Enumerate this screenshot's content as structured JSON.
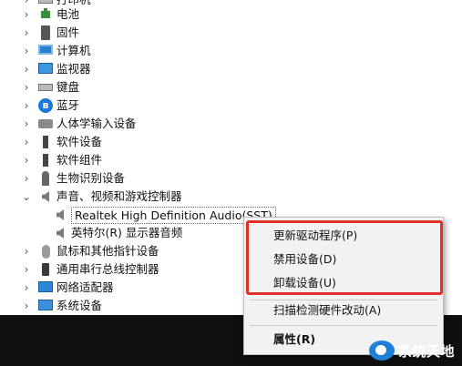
{
  "tree": {
    "items": [
      {
        "label": "打印机",
        "icon": "printer-icon",
        "chevron": "›"
      },
      {
        "label": "电池",
        "icon": "battery-icon",
        "chevron": "›"
      },
      {
        "label": "固件",
        "icon": "firmware-icon",
        "chevron": "›"
      },
      {
        "label": "计算机",
        "icon": "computer-icon",
        "chevron": "›"
      },
      {
        "label": "监视器",
        "icon": "monitor-icon",
        "chevron": "›"
      },
      {
        "label": "键盘",
        "icon": "keyboard-icon",
        "chevron": "›"
      },
      {
        "label": "蓝牙",
        "icon": "bluetooth-icon",
        "chevron": "›"
      },
      {
        "label": "人体学输入设备",
        "icon": "hid-icon",
        "chevron": "›"
      },
      {
        "label": "软件设备",
        "icon": "software-device-icon",
        "chevron": "›"
      },
      {
        "label": "软件组件",
        "icon": "software-component-icon",
        "chevron": "›"
      },
      {
        "label": "生物识别设备",
        "icon": "biometric-icon",
        "chevron": "›"
      },
      {
        "label": "声音、视频和游戏控制器",
        "icon": "speaker-icon",
        "chevron": "⌄"
      },
      {
        "label": "Realtek High Definition Audio(SST)",
        "icon": "speaker-icon"
      },
      {
        "label": "英特尔(R) 显示器音频",
        "icon": "speaker-icon"
      },
      {
        "label": "鼠标和其他指针设备",
        "icon": "mouse-icon",
        "chevron": "›"
      },
      {
        "label": "通用串行总线控制器",
        "icon": "usb-icon",
        "chevron": "›"
      },
      {
        "label": "网络适配器",
        "icon": "network-icon",
        "chevron": "›"
      },
      {
        "label": "系统设备",
        "icon": "system-icon",
        "chevron": "›"
      }
    ]
  },
  "context_menu": {
    "update_driver": "更新驱动程序(P)",
    "disable_device": "禁用设备(D)",
    "uninstall_device": "卸载设备(U)",
    "scan_hardware": "扫描检测硬件改动(A)",
    "properties": "属性(R)"
  },
  "watermark": {
    "text": "系统天地"
  },
  "colors": {
    "highlight_border": "#e0312b",
    "menu_background": "#f2f2f2",
    "bottom_bar": "#0f0f0f"
  }
}
